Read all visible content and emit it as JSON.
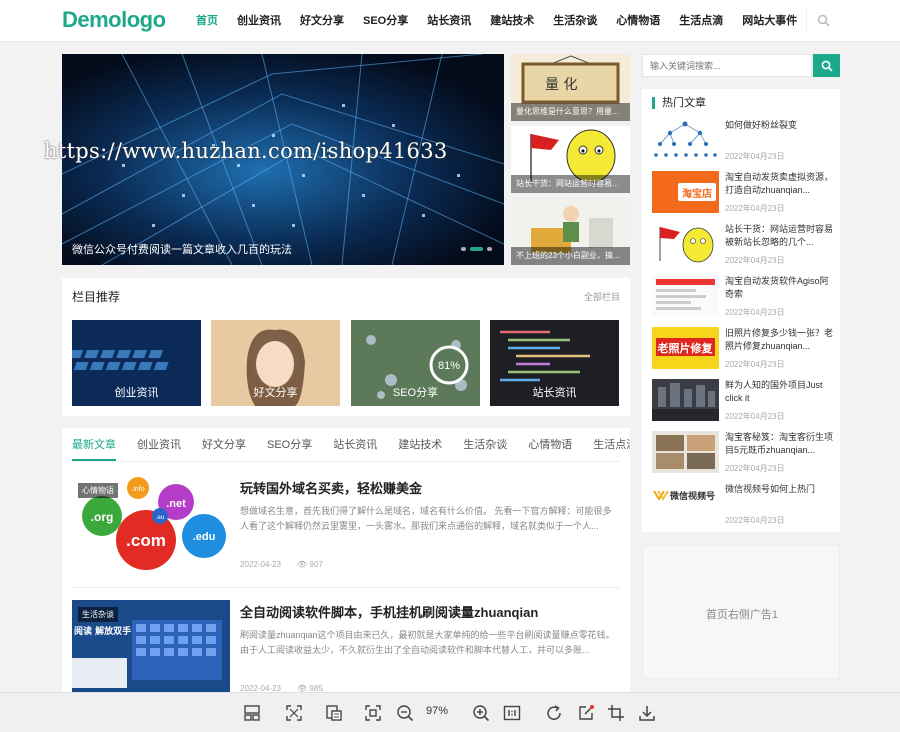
{
  "header": {
    "logo": "Demologo",
    "nav": [
      "首页",
      "创业资讯",
      "好文分享",
      "SEO分享",
      "站长资讯",
      "建站技术",
      "生活杂谈",
      "心情物语",
      "生活点滴",
      "网站大事件"
    ],
    "active_nav": 0
  },
  "slider": {
    "title": "微信公众号付费阅读一篇文章收入几百的玩法",
    "dots": 3,
    "active_dot": 1
  },
  "thumbs": [
    {
      "caption": "量化思维是什么意思？用量...",
      "sign_text": "量 化"
    },
    {
      "caption": "站长干货：网站运营时容易..."
    },
    {
      "caption": "不上班的23个小白副业，搞..."
    }
  ],
  "watermark": "https://www.huzhan.com/ishop41633",
  "columns": {
    "title": "栏目推荐",
    "more": "全部栏目",
    "items": [
      {
        "label": "创业资讯"
      },
      {
        "label": "好文分享"
      },
      {
        "label": "SEO分享",
        "badge": "81%"
      },
      {
        "label": "站长资讯"
      }
    ]
  },
  "tabs": [
    "最新文章",
    "创业资讯",
    "好文分享",
    "SEO分享",
    "站长资讯",
    "建站技术",
    "生活杂谈",
    "心情物语",
    "生活点滴"
  ],
  "articles": [
    {
      "category": "心情物语",
      "title": "玩转国外域名买卖，轻松赚美金",
      "summary": "想做域名生意，首先我们得了解什么是域名，域名有什么价值。 先看一下官方解释：可能很多人看了这个解释仍然云里雾里，一头雾水。那我们来点通俗的解释，域名就类似于一个人...",
      "date": "2022-04-23",
      "views": "907",
      "domains": [
        ".com",
        ".org",
        ".net",
        ".edu",
        ".info",
        ".eu"
      ]
    },
    {
      "category": "生活杂谈",
      "title": "全自动阅读软件脚本，手机挂机刷阅读量zhuanqian",
      "summary": "刷阅读量zhuanqian这个项目由来已久，最初就是大家单纯的给一些平台刷阅读量赚点零花钱。 由于人工阅读收益太少，不久就衍生出了全自动阅读软件和脚本代替人工，并可以多账...",
      "date": "2022-04-23",
      "views": "985",
      "thumb_text": "阅读 解放双手"
    }
  ],
  "sidebar": {
    "search_placeholder": "输入关键词搜索...",
    "hot_title": "热门文章",
    "hot": [
      {
        "title": "如何做好粉丝裂变",
        "date": "2022年04月23日"
      },
      {
        "title": "淘宝自动发货卖虚拟资源，打造自动zhuanqian...",
        "date": "2022年04月23日",
        "thumb_text": "淘宝店"
      },
      {
        "title": "站长干货：网站运营时容易被新站长忽略的几个...",
        "date": "2022年04月23日"
      },
      {
        "title": "淘宝自动发货软件Agiso阿奇索",
        "date": "2022年04月23日"
      },
      {
        "title": "旧照片修复多少钱一张？老照片修复zhuanqian...",
        "date": "2022年04月23日",
        "thumb_text": "老照片修复"
      },
      {
        "title": "鲜为人知的国外项目Just click it",
        "date": "2022年04月23日"
      },
      {
        "title": "淘宝客秘笈：淘宝客衍生项目5元既币zhuanqian...",
        "date": "2022年04月23日"
      },
      {
        "title": "微信视频号如何上热门",
        "date": "2022年04月23日",
        "thumb_text": "微信视频号"
      }
    ],
    "ad_text": "首页右侧广告1"
  },
  "viewer": {
    "zoom": "97%"
  },
  "colors": {
    "accent": "#1ca88a",
    "logo_blue": "#1b7fb5"
  }
}
